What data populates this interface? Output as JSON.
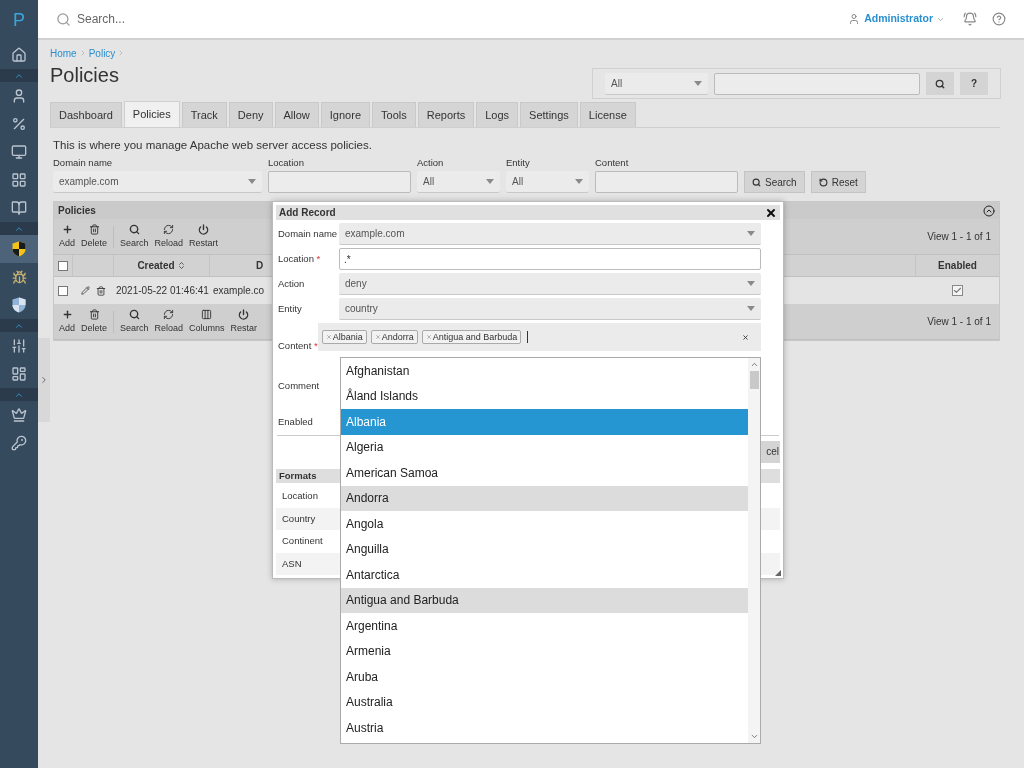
{
  "sidebar": {
    "logo": "P",
    "items": [
      {
        "kind": "link",
        "selected": false
      },
      {
        "kind": "divider"
      },
      {
        "kind": "link",
        "selected": false
      },
      {
        "kind": "link",
        "selected": false
      },
      {
        "kind": "link",
        "selected": false
      },
      {
        "kind": "link",
        "selected": false
      },
      {
        "kind": "link",
        "selected": false
      },
      {
        "kind": "divider"
      },
      {
        "kind": "link",
        "selected": true
      },
      {
        "kind": "link",
        "selected": false
      },
      {
        "kind": "link",
        "selected": false
      },
      {
        "kind": "divider"
      },
      {
        "kind": "link",
        "selected": false
      },
      {
        "kind": "link",
        "selected": false
      },
      {
        "kind": "divider"
      },
      {
        "kind": "link",
        "selected": false
      },
      {
        "kind": "link",
        "selected": false
      }
    ]
  },
  "topbar": {
    "search_placeholder": "Search...",
    "user": "Administrator"
  },
  "breadcrumb": [
    "Home",
    "Policy"
  ],
  "title": "Policies",
  "quick_search": {
    "scope": "All",
    "help": "?"
  },
  "tabs": [
    {
      "label": "Dashboard",
      "selected": false
    },
    {
      "label": "Policies",
      "selected": true
    },
    {
      "label": "Track",
      "selected": false
    },
    {
      "label": "Deny",
      "selected": false
    },
    {
      "label": "Allow",
      "selected": false
    },
    {
      "label": "Ignore",
      "selected": false
    },
    {
      "label": "Tools",
      "selected": false
    },
    {
      "label": "Reports",
      "selected": false
    },
    {
      "label": "Logs",
      "selected": false
    },
    {
      "label": "Settings",
      "selected": false
    },
    {
      "label": "License",
      "selected": false
    }
  ],
  "description": "This is where you manage Apache web server access policies.",
  "filters": [
    {
      "label": "Domain name",
      "kind": "select",
      "value": "example.com"
    },
    {
      "label": "Location",
      "kind": "input"
    },
    {
      "label": "Action",
      "kind": "select",
      "value": "All"
    },
    {
      "label": "Entity",
      "kind": "select",
      "value": "All"
    },
    {
      "label": "Content",
      "kind": "input"
    }
  ],
  "filter_buttons": [
    {
      "label": "Search",
      "kind": "search"
    },
    {
      "label": "Reset",
      "kind": "reset"
    }
  ],
  "panel": {
    "title": "Policies",
    "top_toolbar": [
      {
        "label": "Add",
        "kind": "add"
      },
      {
        "label": "Delete",
        "kind": "delete"
      },
      {
        "label": "Search",
        "kind": "search"
      },
      {
        "label": "Reload",
        "kind": "reload"
      },
      {
        "label": "Restart",
        "kind": "restart"
      }
    ],
    "pager": "View 1 - 1 of 1",
    "header_checked": false,
    "columns": [
      "Created",
      "D",
      "Enabled"
    ],
    "rows": [
      {
        "checked": false,
        "created": "2021-05-22 01:46:41",
        "domain": "example.co",
        "enabled": true
      }
    ],
    "bottom_toolbar": [
      {
        "label": "Add",
        "kind": "add"
      },
      {
        "label": "Delete",
        "kind": "delete"
      },
      {
        "label": "Search",
        "kind": "search"
      },
      {
        "label": "Reload",
        "kind": "reload"
      },
      {
        "label": "Columns",
        "kind": "columns"
      },
      {
        "label": "Restar",
        "kind": "restart"
      }
    ],
    "bottom_pager": "View 1 - 1 of 1"
  },
  "dialog": {
    "title": "Add Record",
    "fields": [
      {
        "label": "Domain name",
        "kind": "select",
        "value": "example.com"
      },
      {
        "label": "Location",
        "required_mark": "*",
        "kind": "input",
        "value": ".*"
      },
      {
        "label": "Action",
        "kind": "select",
        "value": "deny"
      },
      {
        "label": "Entity",
        "kind": "select",
        "value": "country"
      },
      {
        "label": "Content",
        "required_mark": "*",
        "kind": "tags",
        "tags": [
          "Albania",
          "Andorra",
          "Antigua and Barbuda"
        ]
      },
      {
        "label": "Comment",
        "kind": "blank"
      },
      {
        "label": "Enabled",
        "kind": "blank"
      }
    ],
    "button": "cel",
    "formats": {
      "title": "Formats",
      "rows": [
        "Location",
        "Country",
        "Continent",
        "ASN"
      ]
    }
  },
  "dropdown": {
    "options": [
      {
        "label": "Afghanistan",
        "selected": false,
        "highlighted": false
      },
      {
        "label": "Åland Islands",
        "selected": false,
        "highlighted": false
      },
      {
        "label": "Albania",
        "selected": true,
        "highlighted": true
      },
      {
        "label": "Algeria",
        "selected": false,
        "highlighted": false
      },
      {
        "label": "American Samoa",
        "selected": false,
        "highlighted": false
      },
      {
        "label": "Andorra",
        "selected": true,
        "highlighted": false
      },
      {
        "label": "Angola",
        "selected": false,
        "highlighted": false
      },
      {
        "label": "Anguilla",
        "selected": false,
        "highlighted": false
      },
      {
        "label": "Antarctica",
        "selected": false,
        "highlighted": false
      },
      {
        "label": "Antigua and Barbuda",
        "selected": true,
        "highlighted": false
      },
      {
        "label": "Argentina",
        "selected": false,
        "highlighted": false
      },
      {
        "label": "Armenia",
        "selected": false,
        "highlighted": false
      },
      {
        "label": "Aruba",
        "selected": false,
        "highlighted": false
      },
      {
        "label": "Australia",
        "selected": false,
        "highlighted": false
      },
      {
        "label": "Austria",
        "selected": false,
        "highlighted": false
      }
    ]
  }
}
